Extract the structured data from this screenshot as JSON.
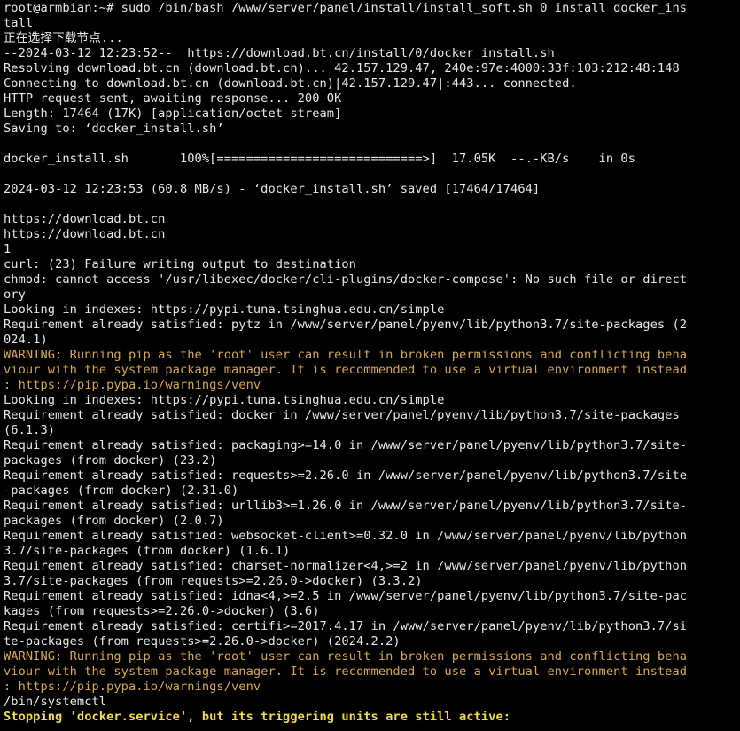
{
  "terminal": {
    "colors": {
      "background": "#000000",
      "normal": "#e8e8e8",
      "warning": "#d7a84a",
      "highlight": "#f0dc46"
    },
    "lines": [
      {
        "text": "root@armbian:~# sudo /bin/bash /www/server/panel/install/install_soft.sh 0 install docker_ins",
        "style": "normal"
      },
      {
        "text": "tall",
        "style": "normal"
      },
      {
        "text": "正在选择下载节点...",
        "style": "normal"
      },
      {
        "text": "--2024-03-12 12:23:52--  https://download.bt.cn/install/0/docker_install.sh",
        "style": "normal"
      },
      {
        "text": "Resolving download.bt.cn (download.bt.cn)... 42.157.129.47, 240e:97e:4000:33f:103:212:48:148",
        "style": "normal"
      },
      {
        "text": "Connecting to download.bt.cn (download.bt.cn)|42.157.129.47|:443... connected.",
        "style": "normal"
      },
      {
        "text": "HTTP request sent, awaiting response... 200 OK",
        "style": "normal"
      },
      {
        "text": "Length: 17464 (17K) [application/octet-stream]",
        "style": "normal"
      },
      {
        "text": "Saving to: ‘docker_install.sh’",
        "style": "normal"
      },
      {
        "text": "",
        "style": "normal"
      },
      {
        "text": "docker_install.sh       100%[============================>]  17.05K  --.-KB/s    in 0s",
        "style": "normal"
      },
      {
        "text": "",
        "style": "normal"
      },
      {
        "text": "2024-03-12 12:23:53 (60.8 MB/s) - ‘docker_install.sh’ saved [17464/17464]",
        "style": "normal"
      },
      {
        "text": "",
        "style": "normal"
      },
      {
        "text": "https://download.bt.cn",
        "style": "normal"
      },
      {
        "text": "https://download.bt.cn",
        "style": "normal"
      },
      {
        "text": "1",
        "style": "normal"
      },
      {
        "text": "curl: (23) Failure writing output to destination",
        "style": "normal"
      },
      {
        "text": "chmod: cannot access '/usr/libexec/docker/cli-plugins/docker-compose': No such file or direct",
        "style": "normal"
      },
      {
        "text": "ory",
        "style": "normal"
      },
      {
        "text": "Looking in indexes: https://pypi.tuna.tsinghua.edu.cn/simple",
        "style": "normal"
      },
      {
        "text": "Requirement already satisfied: pytz in /www/server/panel/pyenv/lib/python3.7/site-packages (2",
        "style": "normal"
      },
      {
        "text": "024.1)",
        "style": "normal"
      },
      {
        "text": "WARNING: Running pip as the 'root' user can result in broken permissions and conflicting beha",
        "style": "warn"
      },
      {
        "text": "viour with the system package manager. It is recommended to use a virtual environment instead",
        "style": "warn"
      },
      {
        "text": ": https://pip.pypa.io/warnings/venv",
        "style": "warn"
      },
      {
        "text": "Looking in indexes: https://pypi.tuna.tsinghua.edu.cn/simple",
        "style": "normal"
      },
      {
        "text": "Requirement already satisfied: docker in /www/server/panel/pyenv/lib/python3.7/site-packages",
        "style": "normal"
      },
      {
        "text": "(6.1.3)",
        "style": "normal"
      },
      {
        "text": "Requirement already satisfied: packaging>=14.0 in /www/server/panel/pyenv/lib/python3.7/site-",
        "style": "normal"
      },
      {
        "text": "packages (from docker) (23.2)",
        "style": "normal"
      },
      {
        "text": "Requirement already satisfied: requests>=2.26.0 in /www/server/panel/pyenv/lib/python3.7/site",
        "style": "normal"
      },
      {
        "text": "-packages (from docker) (2.31.0)",
        "style": "normal"
      },
      {
        "text": "Requirement already satisfied: urllib3>=1.26.0 in /www/server/panel/pyenv/lib/python3.7/site-",
        "style": "normal"
      },
      {
        "text": "packages (from docker) (2.0.7)",
        "style": "normal"
      },
      {
        "text": "Requirement already satisfied: websocket-client>=0.32.0 in /www/server/panel/pyenv/lib/python",
        "style": "normal"
      },
      {
        "text": "3.7/site-packages (from docker) (1.6.1)",
        "style": "normal"
      },
      {
        "text": "Requirement already satisfied: charset-normalizer<4,>=2 in /www/server/panel/pyenv/lib/python",
        "style": "normal"
      },
      {
        "text": "3.7/site-packages (from requests>=2.26.0->docker) (3.3.2)",
        "style": "normal"
      },
      {
        "text": "Requirement already satisfied: idna<4,>=2.5 in /www/server/panel/pyenv/lib/python3.7/site-pac",
        "style": "normal"
      },
      {
        "text": "kages (from requests>=2.26.0->docker) (3.6)",
        "style": "normal"
      },
      {
        "text": "Requirement already satisfied: certifi>=2017.4.17 in /www/server/panel/pyenv/lib/python3.7/si",
        "style": "normal"
      },
      {
        "text": "te-packages (from requests>=2.26.0->docker) (2024.2.2)",
        "style": "normal"
      },
      {
        "text": "WARNING: Running pip as the 'root' user can result in broken permissions and conflicting beha",
        "style": "warn"
      },
      {
        "text": "viour with the system package manager. It is recommended to use a virtual environment instead",
        "style": "warn"
      },
      {
        "text": ": https://pip.pypa.io/warnings/venv",
        "style": "warn"
      },
      {
        "text": "/bin/systemctl",
        "style": "normal"
      },
      {
        "text": "Stopping 'docker.service', but its triggering units are still active:",
        "style": "bold-warn"
      }
    ]
  }
}
